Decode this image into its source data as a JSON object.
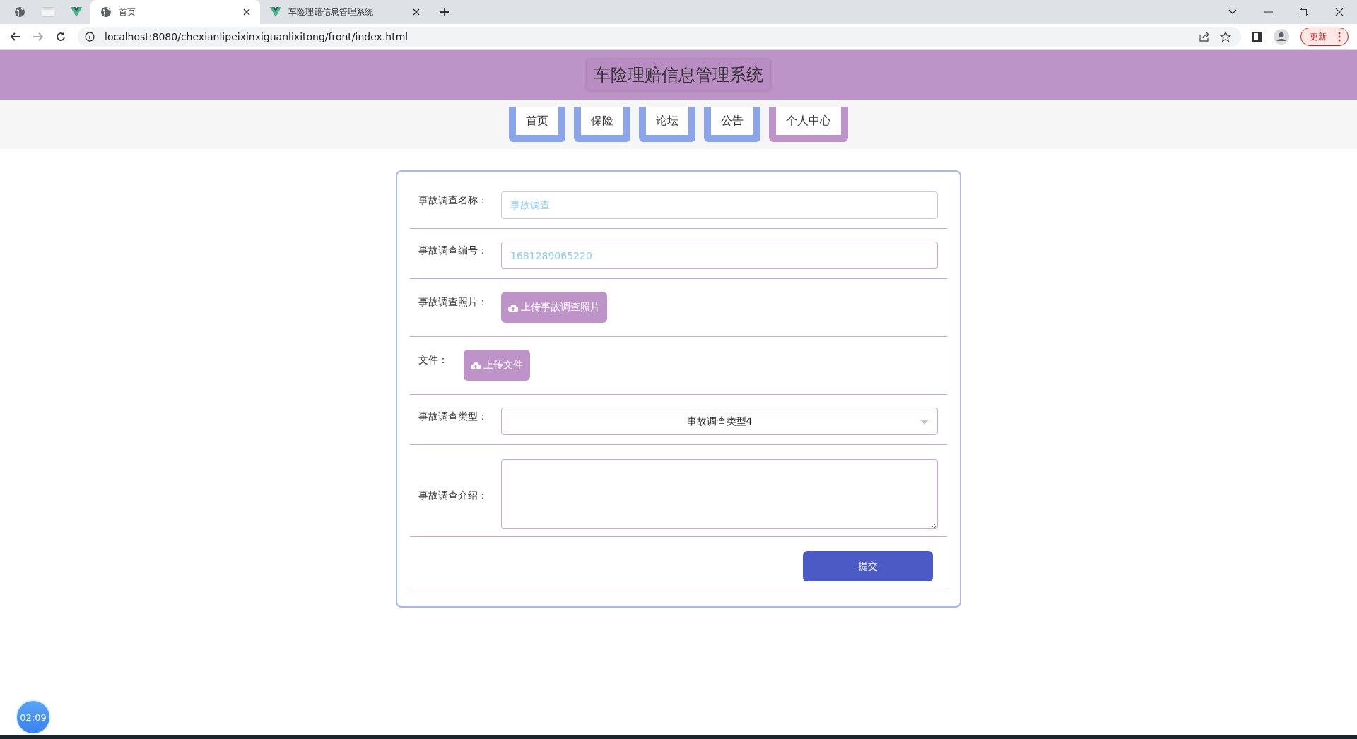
{
  "browser": {
    "tabs": [
      {
        "kind": "icon",
        "selected": false
      },
      {
        "kind": "icon",
        "selected": false
      },
      {
        "kind": "icon",
        "selected": false
      },
      {
        "kind": "page",
        "title": "首页",
        "selected": true
      },
      {
        "kind": "page",
        "title": "车险理赔信息管理系统",
        "selected": false
      }
    ],
    "url": "localhost:8080/chexianlipeixinxiguanlixitong/front/index.html",
    "update_button": "更新"
  },
  "header": {
    "title": "车险理赔信息管理系统"
  },
  "nav": [
    {
      "label": "首页",
      "selected": false
    },
    {
      "label": "保险",
      "selected": false
    },
    {
      "label": "论坛",
      "selected": false
    },
    {
      "label": "公告",
      "selected": false
    },
    {
      "label": "个人中心",
      "selected": true
    }
  ],
  "form": {
    "fields": [
      {
        "kind": "input",
        "label": "事故调查名称：",
        "value": "事故调查"
      },
      {
        "kind": "input",
        "label": "事故调查编号：",
        "value": "1681289065220"
      },
      {
        "kind": "upload",
        "label": "事故调查照片：",
        "button": "上传事故调查照片"
      },
      {
        "kind": "upload",
        "label": "文件：",
        "button": "上传文件"
      },
      {
        "kind": "select",
        "label": "事故调查类型：",
        "value": "事故调查类型4"
      },
      {
        "kind": "textarea",
        "label": "事故调查介绍："
      }
    ],
    "submit": "提交"
  },
  "timer": "02:09"
}
